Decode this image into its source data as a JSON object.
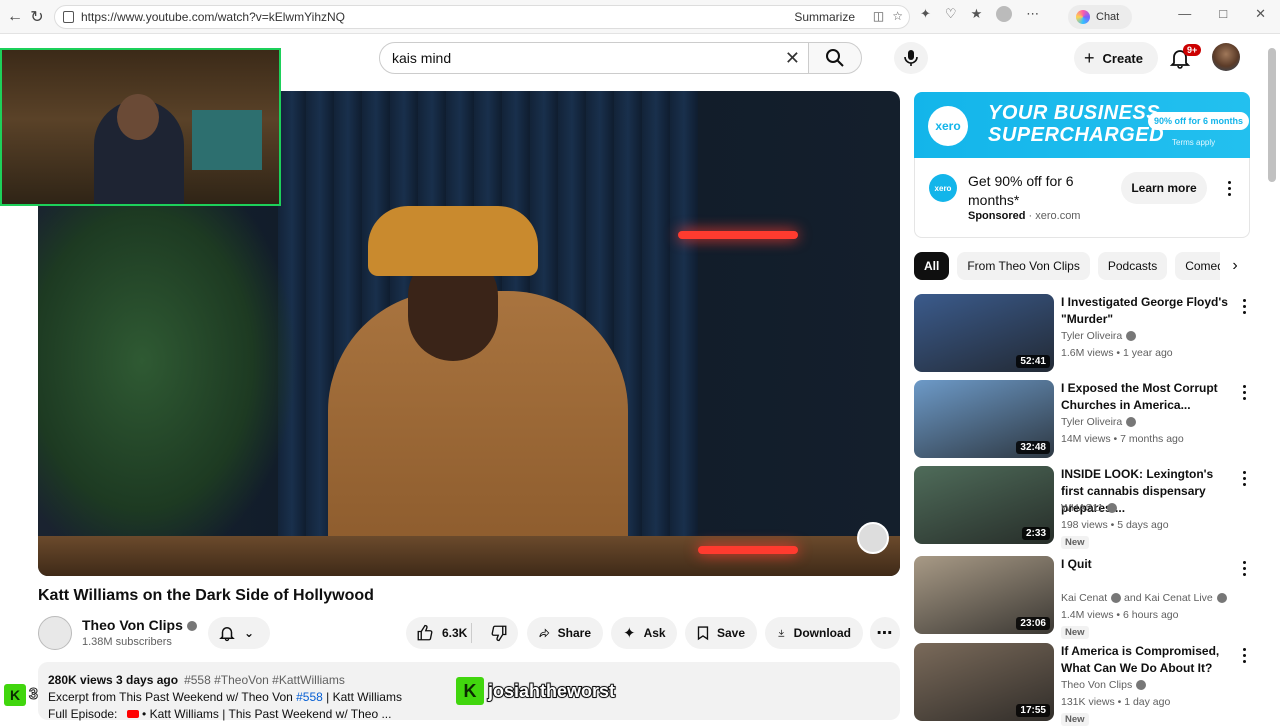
{
  "browser": {
    "url": "https://www.youtube.com/watch?v=kElwmYihzNQ",
    "summarize_label": "Summarize",
    "chat_label": "Chat"
  },
  "search": {
    "query": "kais mind"
  },
  "header": {
    "create_label": "Create",
    "notification_count": "9+"
  },
  "video": {
    "title": "Katt Williams on the Dark Side of Hollywood",
    "channel": "Theo Von Clips",
    "subscribers": "1.38M subscribers",
    "likes": "6.3K",
    "actions": {
      "share": "Share",
      "ask": "Ask",
      "save": "Save",
      "download": "Download"
    },
    "description": {
      "stats": "280K views  3 days ago",
      "tags": "#558 #TheoVon #KattWilliams",
      "line2_prefix": "Excerpt from This Past Weekend w/ Theo Von ",
      "line2_link": "#558",
      "line2_suffix": " | Katt Williams",
      "line3_prefix": "Full Episode:",
      "line3_text": " • Katt Williams | This Past Weekend w/ Theo ..."
    }
  },
  "overlay": {
    "streamer_name": "josiahtheworst",
    "brand_letter": "K",
    "corner_count": "3"
  },
  "ad": {
    "banner_brand": "xero",
    "banner_headline_1": "YOUR BUSINESS",
    "banner_headline_2": "SUPERCHARGED",
    "banner_offer": "90% off for 6 months",
    "banner_terms": "Terms apply",
    "text": "Get 90% off for 6 months*",
    "sponsored": "Sponsored",
    "domain": "xero.com",
    "cta": "Learn more"
  },
  "chips": [
    "All",
    "From Theo Von Clips",
    "Podcasts",
    "Comedy"
  ],
  "recommendations": [
    {
      "title": "I Investigated George Floyd's \"Murder\"",
      "channel": "Tyler Oliveira",
      "meta": "1.6M views • 1 year ago",
      "duration": "52:41",
      "new": "",
      "thumb_color": "#3b5b8c"
    },
    {
      "title": "I Exposed the Most Corrupt Churches in America...",
      "channel": "Tyler Oliveira",
      "meta": "14M views • 7 months ago",
      "duration": "32:48",
      "new": "",
      "thumb_color": "#6d9ac8"
    },
    {
      "title": "INSIDE LOOK: Lexington's first cannabis dispensary prepares ...",
      "channel": "WHAS11",
      "meta": "198 views • 5 days ago",
      "duration": "2:33",
      "new": "New",
      "thumb_color": "#4f6c5a"
    },
    {
      "title": "I Quit",
      "channel": "Kai Cenat",
      "channel_extra": "and Kai Cenat Live",
      "meta": "1.4M views • 6 hours ago",
      "duration": "23:06",
      "new": "New",
      "thumb_color": "#a89a86"
    },
    {
      "title": "If America is Compromised, What Can We Do About It?",
      "channel": "Theo Von Clips",
      "meta": "131K views • 1 day ago",
      "duration": "17:55",
      "new": "New",
      "thumb_color": "#7a6a5a"
    }
  ]
}
